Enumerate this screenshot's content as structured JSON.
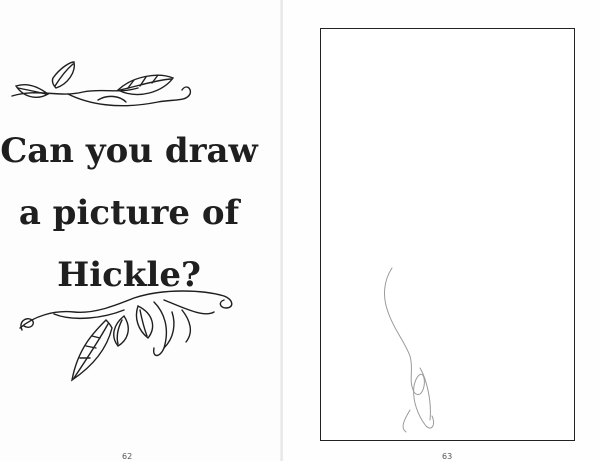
{
  "left_page": {
    "heading_lines": [
      "Can you draw",
      "a picture of",
      "Hickle?"
    ],
    "page_number": "62"
  },
  "right_page": {
    "page_number": "63"
  },
  "decorations": {
    "top_ornament": "leaf-vine-icon",
    "bottom_ornament": "leaf-vine-icon",
    "sketch": "pencil-scribble"
  },
  "colors": {
    "ink": "#1f1f1f",
    "paper": "#fefefe",
    "pencil": "#9a9a9a"
  }
}
